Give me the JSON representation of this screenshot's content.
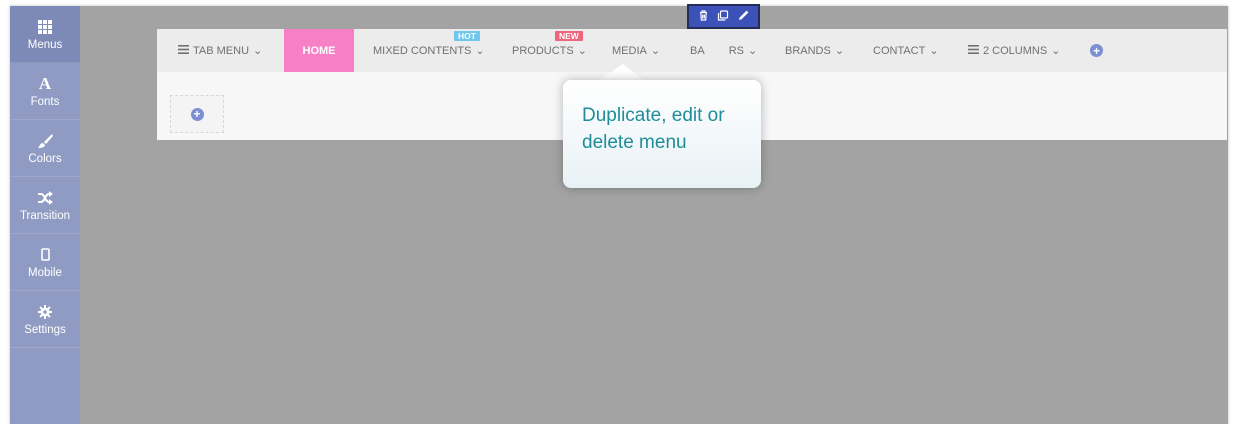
{
  "sidebar": {
    "items": [
      {
        "label": "Menus",
        "icon": "grid-icon"
      },
      {
        "label": "Fonts",
        "icon": "font-icon",
        "glyph": "A"
      },
      {
        "label": "Colors",
        "icon": "brush-icon"
      },
      {
        "label": "Transition",
        "icon": "shuffle-icon"
      },
      {
        "label": "Mobile",
        "icon": "mobile-icon"
      },
      {
        "label": "Settings",
        "icon": "gear-icon"
      }
    ]
  },
  "menubar": {
    "items": [
      {
        "label": "TAB MENU",
        "icon": "hamburger-icon",
        "chevron": "⌄"
      },
      {
        "label": "HOME"
      },
      {
        "label": "MIXED CONTENTS",
        "badge": "HOT",
        "chevron": "⌄"
      },
      {
        "label": "PRODUCTS",
        "badge": "NEW",
        "chevron": "⌄"
      },
      {
        "label": "MEDIA",
        "chevron": "⌄"
      },
      {
        "label": "BA",
        "label_end": "RS",
        "chevron": "⌄"
      },
      {
        "label": "BRANDS",
        "chevron": "⌄"
      },
      {
        "label": "CONTACT",
        "chevron": "⌄"
      },
      {
        "label": "2 COLUMNS",
        "icon": "hamburger-icon",
        "chevron": "⌄"
      }
    ],
    "add_icon": "+"
  },
  "content": {
    "add_icon": "+"
  },
  "toolbar": {
    "icons": [
      "trash-icon",
      "duplicate-icon",
      "pencil-icon"
    ]
  },
  "tooltip": {
    "line1": "Duplicate, edit or",
    "line2": "delete menu"
  },
  "colors": {
    "sidebar": "#8f9bc3",
    "home_active": "#f77fc6",
    "hot_badge": "#70c6ed",
    "new_badge": "#f0657e",
    "toolbar": "#3c52b8",
    "tooltip_text": "#1f8d99"
  }
}
